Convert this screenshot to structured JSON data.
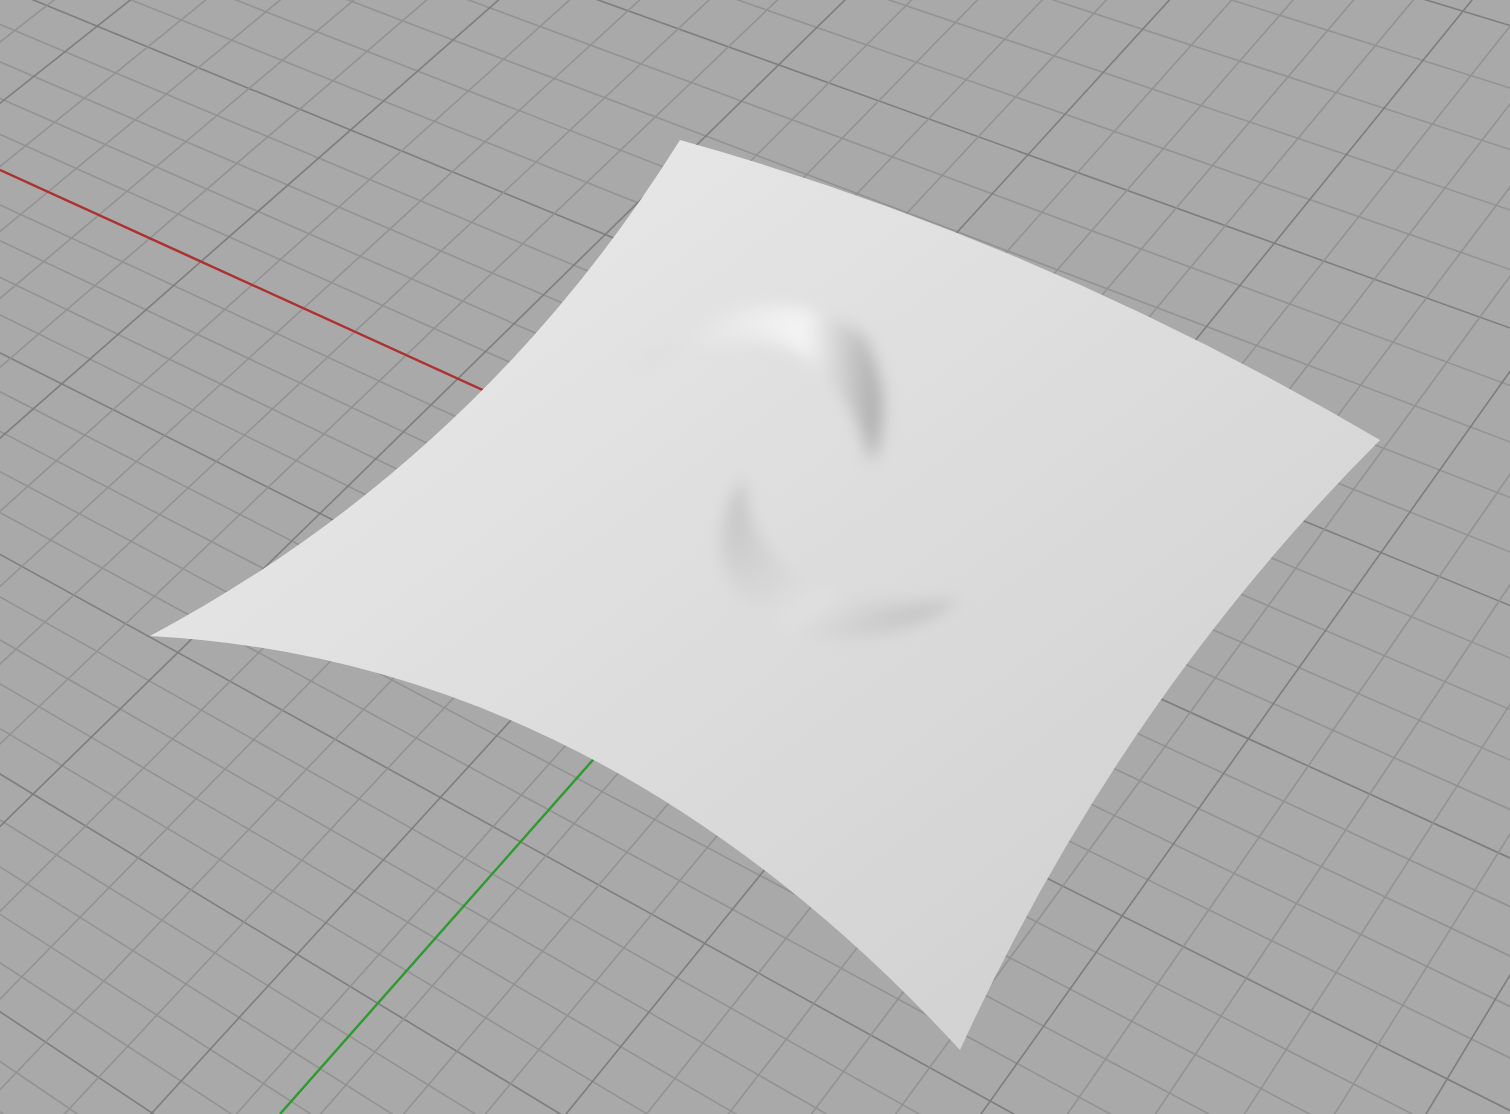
{
  "viewport": {
    "grid": true,
    "axes": true,
    "surface": true
  }
}
